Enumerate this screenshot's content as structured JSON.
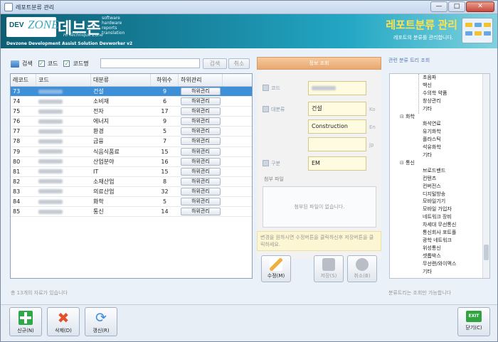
{
  "window": {
    "title": "레포트분류 관리",
    "minimize": "—",
    "maximize": "□",
    "close": "✕"
  },
  "banner": {
    "logo_dev": "DEV",
    "logo_zone": "ZONE",
    "brand_kor": "데브존",
    "brand_sub": "Hi Technique Zone",
    "brand_lines": [
      "software",
      "hardware",
      "reports",
      "translation"
    ],
    "footer": "Devzone Development Assist Solution Devworker v2",
    "page_title": "레포트분류 관리",
    "page_subtitle": "레포트의 분류를 관리합니다."
  },
  "toolbar": {
    "search_label": "검색",
    "code_label": "코드",
    "codename_label": "코드명",
    "code_checked": true,
    "codename_checked": true,
    "search_value": "",
    "search_button": "검색",
    "cancel_button": "취소"
  },
  "grid": {
    "headers": [
      "레코드",
      "코드",
      "대분류",
      "하위수",
      "하위관리"
    ],
    "rows": [
      {
        "id": "73",
        "name": "건설",
        "count": "9",
        "btn": "하위관리",
        "selected": true
      },
      {
        "id": "74",
        "name": "소비재",
        "count": "6",
        "btn": "하위관리"
      },
      {
        "id": "75",
        "name": "전자",
        "count": "17",
        "btn": "하위관리"
      },
      {
        "id": "76",
        "name": "에너지",
        "count": "9",
        "btn": "하위관리"
      },
      {
        "id": "77",
        "name": "환경",
        "count": "5",
        "btn": "하위관리"
      },
      {
        "id": "78",
        "name": "금융",
        "count": "7",
        "btn": "하위관리"
      },
      {
        "id": "79",
        "name": "식음식품료",
        "count": "15",
        "btn": "하위관리"
      },
      {
        "id": "80",
        "name": "산업분야",
        "count": "16",
        "btn": "하위관리"
      },
      {
        "id": "81",
        "name": "IT",
        "count": "15",
        "btn": "하위관리"
      },
      {
        "id": "82",
        "name": "소재산업",
        "count": "8",
        "btn": "하위관리"
      },
      {
        "id": "83",
        "name": "의료산업",
        "count": "32",
        "btn": "하위관리"
      },
      {
        "id": "84",
        "name": "화학",
        "count": "5",
        "btn": "하위관리"
      },
      {
        "id": "85",
        "name": "통신",
        "count": "14",
        "btn": "하위관리"
      }
    ]
  },
  "status_left": "총 13개의 자료가 있습니다",
  "info": {
    "header": "정보 조회",
    "code_label": "코드",
    "major_label": "대분류",
    "kind_label": "구분",
    "name_ko": "건설",
    "name_en": "Construction",
    "name_jp": "",
    "kind_value": "EM",
    "lang_ko": "Ko",
    "lang_en": "En",
    "lang_jp": "Jp",
    "attach_label": "첨부 파일",
    "attach_empty": "첨부된 파일이 없습니다.",
    "hint": "변경을 원하시면 수정버튼을 클릭하신후 저장버튼을 클릭하세요.",
    "edit_button": "수정(M)",
    "save_button": "저장(S)",
    "cancel_button": "취소(B)"
  },
  "tree": {
    "header": "관련 분류 트리 조회",
    "nodes": [
      {
        "text": "초음파",
        "group": false
      },
      {
        "text": "백신",
        "group": false
      },
      {
        "text": "수의학 약품",
        "group": false
      },
      {
        "text": "창상관리",
        "group": false
      },
      {
        "text": "기타",
        "group": false
      },
      {
        "text": "화학",
        "group": true
      },
      {
        "text": "화석연료",
        "group": false
      },
      {
        "text": "유기화학",
        "group": false
      },
      {
        "text": "플라스틱",
        "group": false
      },
      {
        "text": "석유화학",
        "group": false
      },
      {
        "text": "기타",
        "group": false
      },
      {
        "text": "통신",
        "group": true
      },
      {
        "text": "브로드밴드",
        "group": false
      },
      {
        "text": "컨텐츠",
        "group": false
      },
      {
        "text": "컨버전스",
        "group": false
      },
      {
        "text": "디지털방송",
        "group": false
      },
      {
        "text": "모바일기기",
        "group": false
      },
      {
        "text": "모바일 가입자",
        "group": false
      },
      {
        "text": "네트워크 장비",
        "group": false
      },
      {
        "text": "차세대 무선통신",
        "group": false
      },
      {
        "text": "통신회사 포트폴",
        "group": false
      },
      {
        "text": "광학 네트워크",
        "group": false
      },
      {
        "text": "위성통신",
        "group": false
      },
      {
        "text": "셋톱박스",
        "group": false
      },
      {
        "text": "무선랜/와이맥스",
        "group": false
      },
      {
        "text": "기타",
        "group": false
      }
    ],
    "status": "분류트리는 조회만 가능합니다"
  },
  "footer": {
    "new_button": "신규(N)",
    "delete_button": "삭제(D)",
    "refresh_button": "갱신(R)",
    "close_button": "닫기(C)",
    "exit_icon_text": "EXIT"
  },
  "colors": {
    "banner": "#1a8aa6",
    "selected_row": "#3d8fd8",
    "title_yellow": "#ffe34d",
    "info_header": "#e9a871"
  }
}
